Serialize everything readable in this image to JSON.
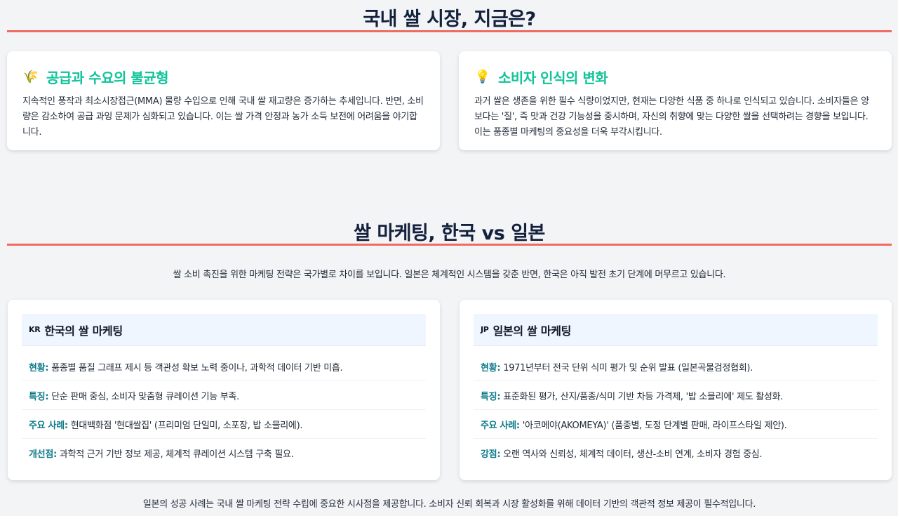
{
  "market": {
    "title": "국내 쌀 시장, 지금은?",
    "cards": [
      {
        "icon": "🌾",
        "icon_name": "rice-plant-icon",
        "title": "공급과 수요의 불균형",
        "body": "지속적인 풍작과 최소시장접근(MMA) 물량 수입으로 인해 국내 쌀 재고량은 증가하는 추세입니다. 반면, 소비량은 감소하여 공급 과잉 문제가 심화되고 있습니다. 이는 쌀 가격 안정과 농가 소득 보전에 어려움을 야기합니다."
      },
      {
        "icon": "💡",
        "icon_name": "light-bulb-icon",
        "title": "소비자 인식의 변화",
        "body": "과거 쌀은 생존을 위한 필수 식량이었지만, 현재는 다양한 식품 중 하나로 인식되고 있습니다. 소비자들은 양보다는 '질', 즉 맛과 건강 기능성을 중시하며, 자신의 취향에 맞는 다양한 쌀을 선택하려는 경향을 보입니다. 이는 품종별 마케팅의 중요성을 더욱 부각시킵니다."
      }
    ]
  },
  "marketing": {
    "title": "쌀 마케팅, 한국 vs 일본",
    "intro": "쌀 소비 촉진을 위한 마케팅 전략은 국가별로 차이를 보입니다. 일본은 체계적인 시스템을 갖춘 반면, 한국은 아직 발전 초기 단계에 머무르고 있습니다.",
    "korea": {
      "flag": "KR",
      "title": "한국의 쌀 마케팅",
      "rows": [
        {
          "label": "현황:",
          "text": "품종별 품질 그래프 제시 등 객관성 확보 노력 중이나, 과학적 데이터 기반 미흡."
        },
        {
          "label": "특징:",
          "text": "단순 판매 중심, 소비자 맞춤형 큐레이션 기능 부족."
        },
        {
          "label": "주요 사례:",
          "text": "현대백화점 '현대쌀집' (프리미엄 단일미, 소포장, 밥 소믈리에)."
        },
        {
          "label": "개선점:",
          "text": "과학적 근거 기반 정보 제공, 체계적 큐레이션 시스템 구축 필요."
        }
      ]
    },
    "japan": {
      "flag": "JP",
      "title": "일본의 쌀 마케팅",
      "rows": [
        {
          "label": "현황:",
          "text": "1971년부터 전국 단위 식미 평가 및 순위 발표 (일본곡물검정협회)."
        },
        {
          "label": "특징:",
          "text": "표준화된 평가, 산지/품종/식미 기반 차등 가격제, '밥 소믈리에' 제도 활성화."
        },
        {
          "label": "주요 사례:",
          "text": "'아코메야(AKOMEYA)' (품종별, 도정 단계별 판매, 라이프스타일 제안)."
        },
        {
          "label": "강점:",
          "text": "오랜 역사와 신뢰성, 체계적 데이터, 생산-소비 연계, 소비자 경험 중심."
        }
      ]
    },
    "closing": "일본의 성공 사례는 국내 쌀 마케팅 전략 수립에 중요한 시사점을 제공합니다. 소비자 신뢰 회복과 시장 활성화를 위해 데이터 기반의 객관적 정보 제공이 필수적입니다."
  }
}
